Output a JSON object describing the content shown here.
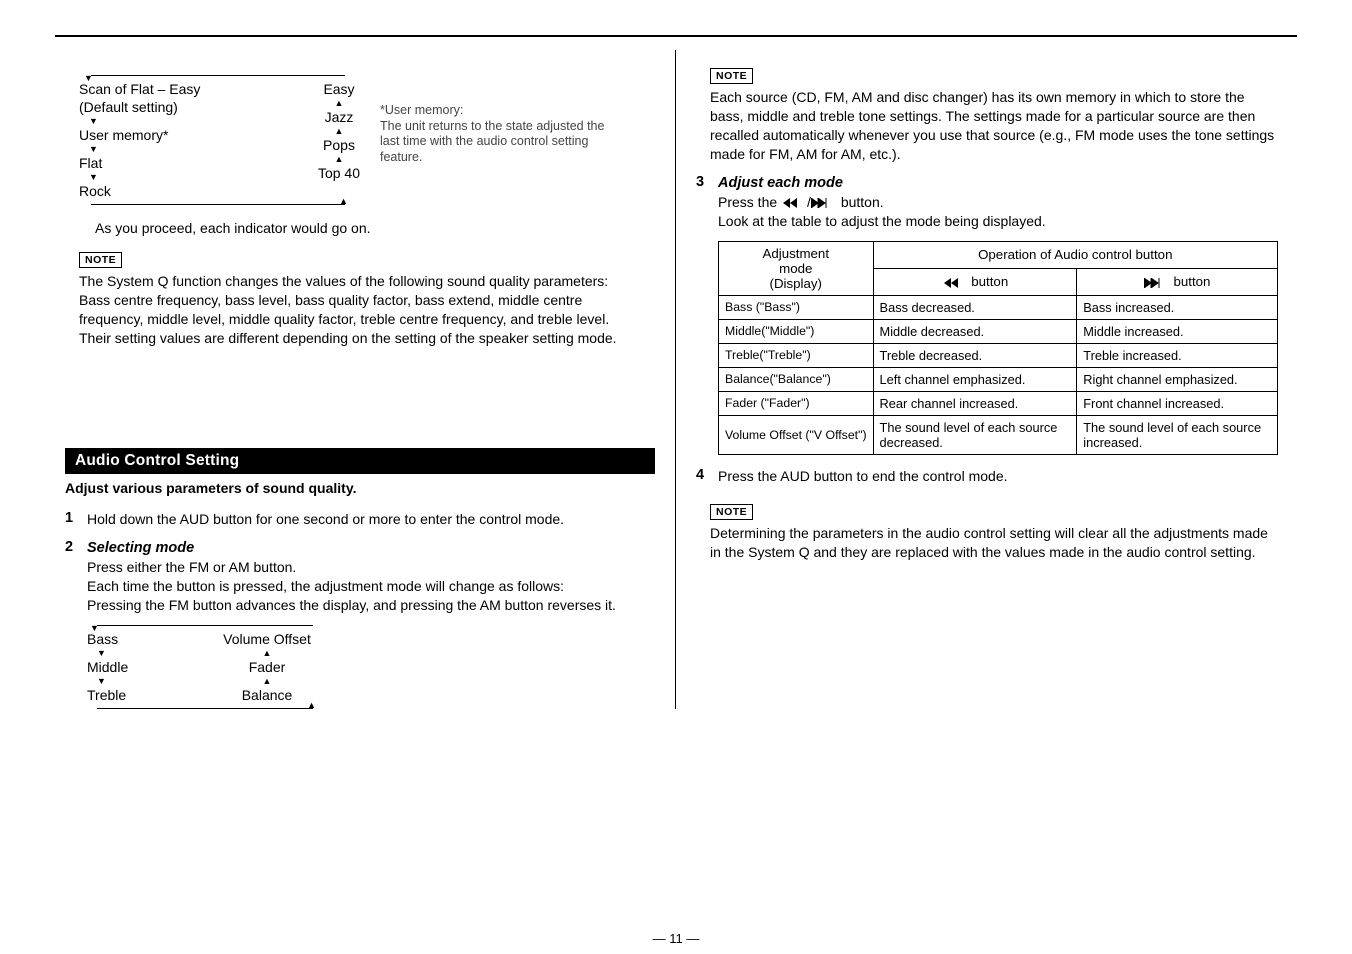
{
  "flow_left": {
    "items": [
      "Scan of Flat – Easy",
      "(Default setting)",
      "User memory*",
      "Flat",
      "Rock"
    ]
  },
  "flow_right": {
    "items": [
      "Easy",
      "Jazz",
      "Pops",
      "Top 40"
    ]
  },
  "user_memory_note": {
    "title": "*User memory:",
    "text": "The unit returns to the state adjusted the last time with the audio control setting feature."
  },
  "proceed_text": "As you proceed, each indicator would go on.",
  "note_label": "NOTE",
  "note1": "The System Q function changes the values of the following sound quality parameters:\nBass centre frequency, bass level, bass quality factor, bass extend, middle centre frequency, middle level, middle quality factor, treble centre frequency, and treble level.\nTheir setting values are different depending on the setting of the speaker setting mode.",
  "section_title": "Audio Control Setting",
  "section_sub": "Adjust various parameters of sound quality.",
  "steps_left": {
    "s1": "Hold down the AUD button for one second or more to enter the control mode.",
    "s2_h": "Selecting mode",
    "s2": "Press either the FM or AM button.\nEach time the button is pressed, the adjustment mode will change as follows:\nPressing the FM button advances the display, and pressing the AM button reverses it."
  },
  "flow2_left": [
    "Bass",
    "Middle",
    "Treble"
  ],
  "flow2_right": [
    "Volume Offset",
    "Fader",
    "Balance"
  ],
  "note2": "Each source (CD, FM, AM and disc changer) has its own memory in which to store the bass, middle and treble tone settings. The settings made for a particular source are then recalled automatically whenever you use that source (e.g., FM mode uses the tone settings made for FM, AM for AM, etc.).",
  "step3_h": "Adjust each mode",
  "step3_line1": "Press the ",
  "step3_line1b": " button.",
  "step3_line2": "Look at the table to adjust the mode being displayed.",
  "table": {
    "h1": "Adjustment mode (Display)",
    "h2": "Operation of Audio control button",
    "h2a_suffix": " button",
    "h2b_suffix": " button",
    "rows": [
      {
        "a": "Bass (\"Bass\")",
        "b": "Bass decreased.",
        "c": "Bass increased."
      },
      {
        "a": "Middle(\"Middle\")",
        "b": "Middle decreased.",
        "c": "Middle increased."
      },
      {
        "a": "Treble(\"Treble\")",
        "b": "Treble decreased.",
        "c": "Treble increased."
      },
      {
        "a": "Balance(\"Balance\")",
        "b": "Left channel emphasized.",
        "c": "Right channel emphasized."
      },
      {
        "a": "Fader (\"Fader\")",
        "b": "Rear channel increased.",
        "c": "Front channel increased."
      },
      {
        "a": "Volume Offset (\"V Offset\")",
        "b": "The sound level of each source decreased.",
        "c": "The sound level of each source increased."
      }
    ]
  },
  "step4": "Press the AUD button to end the control mode.",
  "note3": "Determining the parameters in the audio control setting will clear all the adjustments made in the System Q and they are replaced with the values made in the audio control setting.",
  "pagenum": "— 11 —"
}
